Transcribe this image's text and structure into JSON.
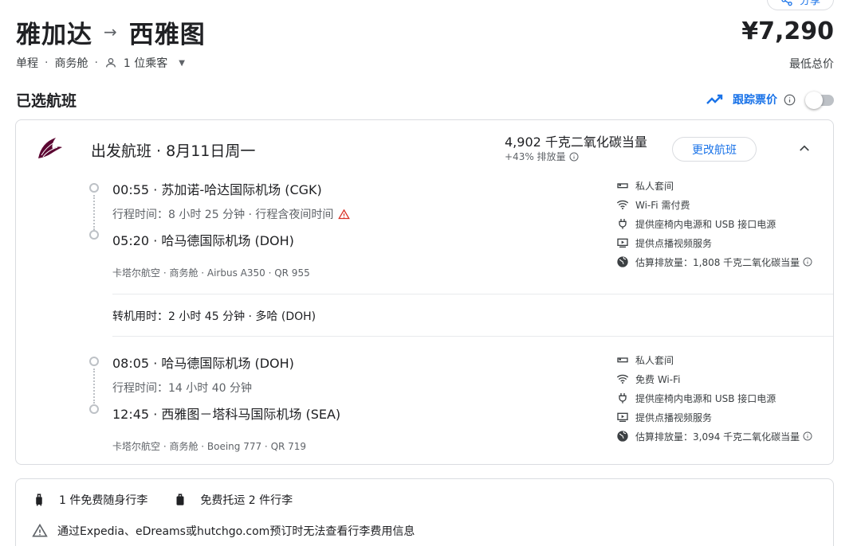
{
  "share": {
    "label": "分享"
  },
  "header": {
    "origin": "雅加达",
    "arrow": "→",
    "destination": "西雅图",
    "trip_type": "单程",
    "cabin": "商务舱",
    "passengers": "1 位乘客",
    "price": "¥7,290",
    "price_label": "最低总价"
  },
  "selected": {
    "title": "已选航班",
    "track_label": "跟踪票价"
  },
  "flight": {
    "title": "出发航班 · 8月11日周一",
    "co2_total": "4,902 千克二氧化碳当量",
    "co2_sub": "+43% 排放量",
    "change_label": "更改航班",
    "segments": [
      {
        "dep": "00:55 · 苏加诺-哈达国际机场 (CGK)",
        "duration": "行程时间：8 小时 25 分钟 · 行程含夜间时间",
        "arr": "05:20 · 哈马德国际机场 (DOH)",
        "carrier": "卡塔尔航空 · 商务舱 · Airbus A350 · QR 955",
        "amenities": [
          "私人套间",
          "Wi-Fi 需付费",
          "提供座椅内电源和 USB 接口电源",
          "提供点播视频服务",
          "估算排放量：1,808 千克二氧化碳当量"
        ]
      },
      {
        "dep": "08:05 · 哈马德国际机场 (DOH)",
        "duration": "行程时间：14 小时 40 分钟",
        "arr": "12:45 · 西雅图－塔科马国际机场 (SEA)",
        "carrier": "卡塔尔航空 · 商务舱 · Boeing 777 · QR 719",
        "amenities": [
          "私人套间",
          "免费 Wi-Fi",
          "提供座椅内电源和 USB 接口电源",
          "提供点播视频服务",
          "估算排放量：3,094 千克二氧化碳当量"
        ]
      }
    ],
    "layover": "转机用时：2 小时 45 分钟 · 多哈 (DOH)"
  },
  "baggage": {
    "carry_on": "1 件免费随身行李",
    "checked": "免费托运 2 件行李",
    "warning": "通过Expedia、eDreams或hutchgo.com预订时无法查看行李费用信息"
  },
  "colors": {
    "accent": "#1a73e8",
    "warning": "#d93025",
    "border": "#dadce0"
  }
}
